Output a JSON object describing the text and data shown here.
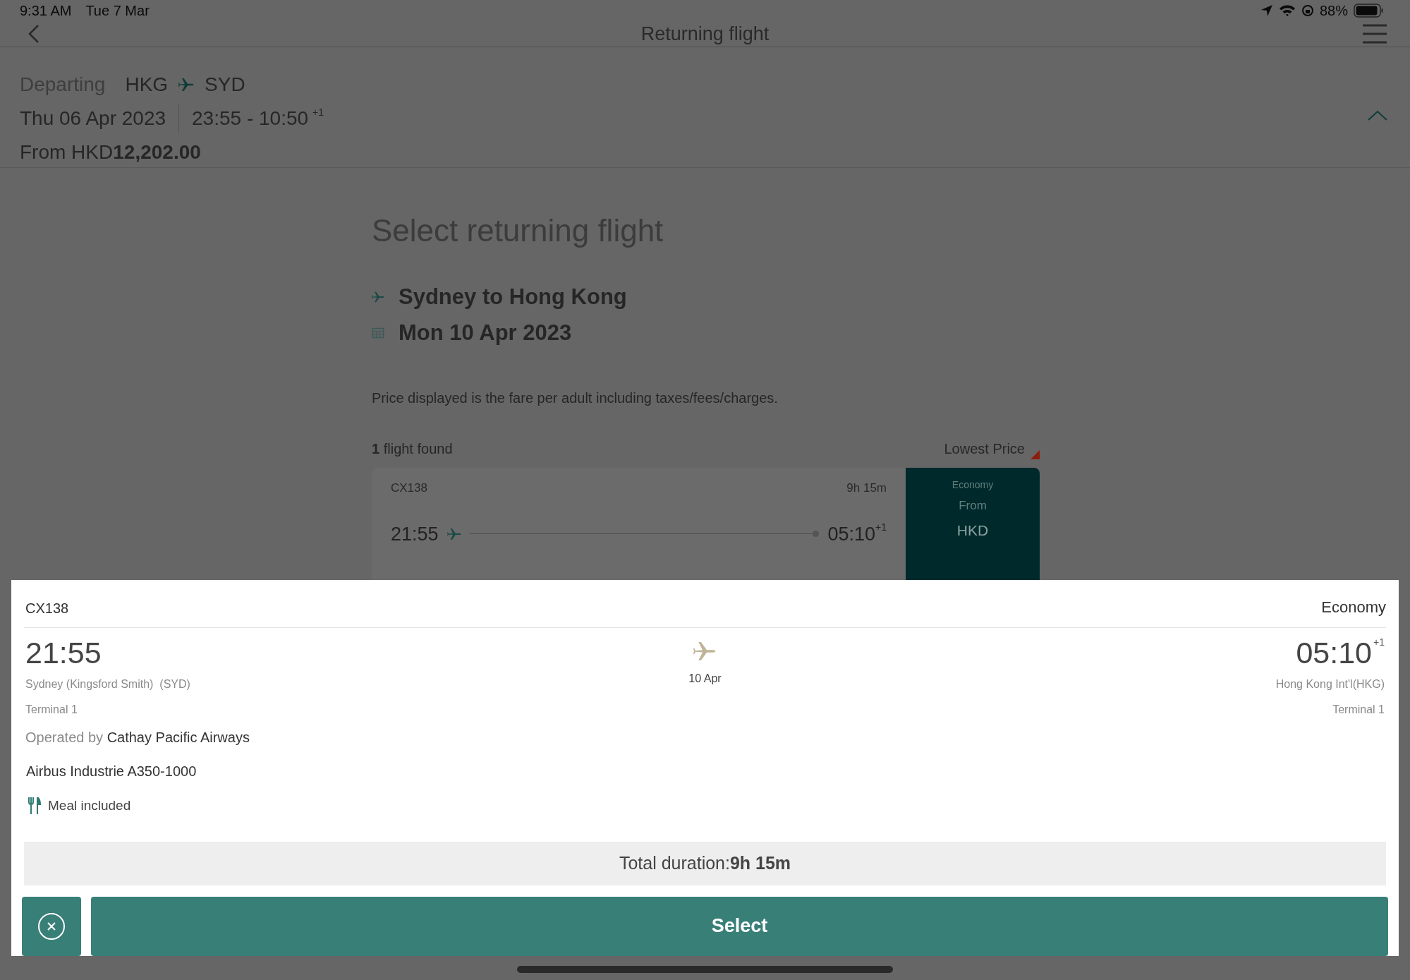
{
  "status_bar": {
    "time": "9:31 AM",
    "date": "Tue 7 Mar",
    "battery": "88%"
  },
  "nav": {
    "title": "Returning flight"
  },
  "departing": {
    "label": "Departing",
    "origin": "HKG",
    "destination": "SYD",
    "date": "Thu 06 Apr 2023",
    "times": "23:55 - 10:50",
    "day_offset": "+1",
    "price_prefix": "From HKD",
    "price": "12,202.00",
    "expanded": true
  },
  "main": {
    "heading": "Select returning flight",
    "route": "Sydney to Hong Kong",
    "date": "Mon 10 Apr 2023",
    "note": "Price displayed is the fare per adult including taxes/fees/charges.",
    "results_count": "**1** flight found",
    "sort": "Lowest Price"
  },
  "flight_card": {
    "flight": "CX138",
    "duration": "9h 15m",
    "depart": "21:55",
    "arrive": "05:10",
    "day_offset": "+1",
    "cabin": "Economy",
    "from": "From",
    "currency": "HKD"
  },
  "sheet": {
    "flight": "CX138",
    "cabin": "Economy",
    "depart_time": "21:55",
    "depart_airport": "Sydney (Kingsford Smith)  (SYD)",
    "depart_terminal": "Terminal 1",
    "date": "10 Apr",
    "arrive_time": "05:10",
    "day_offset": "+1",
    "arrive_airport": "Hong Kong Int'l(HKG)",
    "arrive_terminal": "Terminal 1",
    "operated_label": "Operated by",
    "operator": "Cathay Pacific Airways",
    "aircraft": "Airbus Industrie A350-1000",
    "meal": "Meal included",
    "total": "Total duration:**9h 15m**",
    "select": "Select"
  }
}
